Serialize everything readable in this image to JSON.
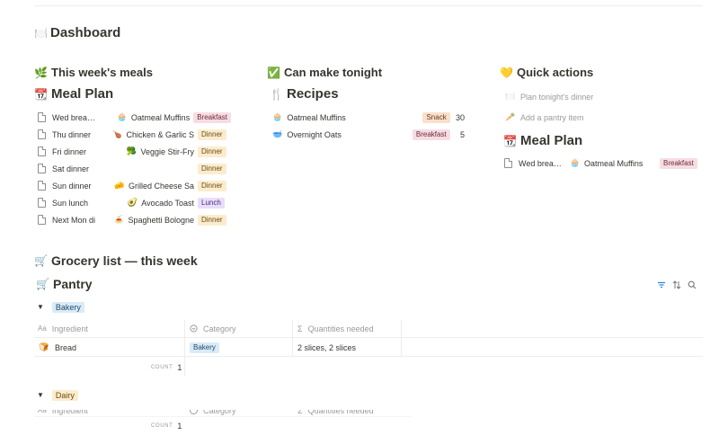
{
  "page": {
    "title": "Dashboard",
    "title_icon": "🍽️"
  },
  "meals_section": {
    "title": "This week's meals",
    "icon": "🌿",
    "db_title": "Meal Plan",
    "db_icon": "📆",
    "rows": [
      {
        "name": "Wed brea…",
        "recipe": "Oatmeal Muffins",
        "recipe_icon": "🧁",
        "tag": "Breakfast"
      },
      {
        "name": "Thu dinner",
        "recipe": "Chicken & Garlic S",
        "recipe_icon": "🍗",
        "tag": "Dinner"
      },
      {
        "name": "Fri dinner",
        "recipe": "Veggie Stir-Fry",
        "recipe_icon": "🥦",
        "tag": "Dinner"
      },
      {
        "name": "Sat dinner",
        "recipe": "",
        "recipe_icon": "",
        "tag": "Dinner"
      },
      {
        "name": "Sun dinner",
        "recipe": "Grilled Cheese Sa",
        "recipe_icon": "🧀",
        "tag": "Dinner"
      },
      {
        "name": "Sun lunch",
        "recipe": "Avocado Toast",
        "recipe_icon": "🥑",
        "tag": "Lunch"
      },
      {
        "name": "Next Mon di…",
        "recipe": "Spaghetti Bologne",
        "recipe_icon": "🍝",
        "tag": "Dinner"
      }
    ]
  },
  "tonight_section": {
    "title": "Can make tonight",
    "icon": "✅",
    "db_title": "Recipes",
    "db_icon": "🍴",
    "rows": [
      {
        "name": "Oatmeal Muffins",
        "icon": "🧁",
        "tag": "Snack",
        "value": "30"
      },
      {
        "name": "Overnight Oats",
        "icon": "🥣",
        "tag": "Breakfast",
        "value": "5"
      }
    ]
  },
  "actions_section": {
    "title": "Quick actions",
    "icon": "💛",
    "buttons": [
      {
        "label": "Plan tonight's dinner",
        "icon": "🍽️"
      },
      {
        "label": "Add a pantry item",
        "icon": "🥕"
      }
    ],
    "db_title": "Meal Plan",
    "db_icon": "📆",
    "rows": [
      {
        "name": "Wed brea…",
        "recipe": "Oatmeal Muffins",
        "recipe_icon": "🧁",
        "tag": "Breakfast"
      }
    ]
  },
  "grocery_section": {
    "title": "Grocery list — this week",
    "icon": "🛒",
    "db_title": "Pantry",
    "db_icon": "🛒",
    "columns": {
      "ingredient": "Ingredient",
      "ingredient_icon": "Aa",
      "category": "Category",
      "quantities": "Quantities needed",
      "quantities_icon": "Σ"
    },
    "groups": [
      {
        "name": "Bakery",
        "rows": [
          {
            "ingredient": "Bread",
            "icon": "🍞",
            "category": "Bakery",
            "quantities": "2 slices, 2 slices"
          }
        ],
        "count_label": "COUNT",
        "count": "1"
      },
      {
        "name": "Dairy",
        "rows": [],
        "count_label": "COUNT",
        "count": "1"
      }
    ]
  }
}
